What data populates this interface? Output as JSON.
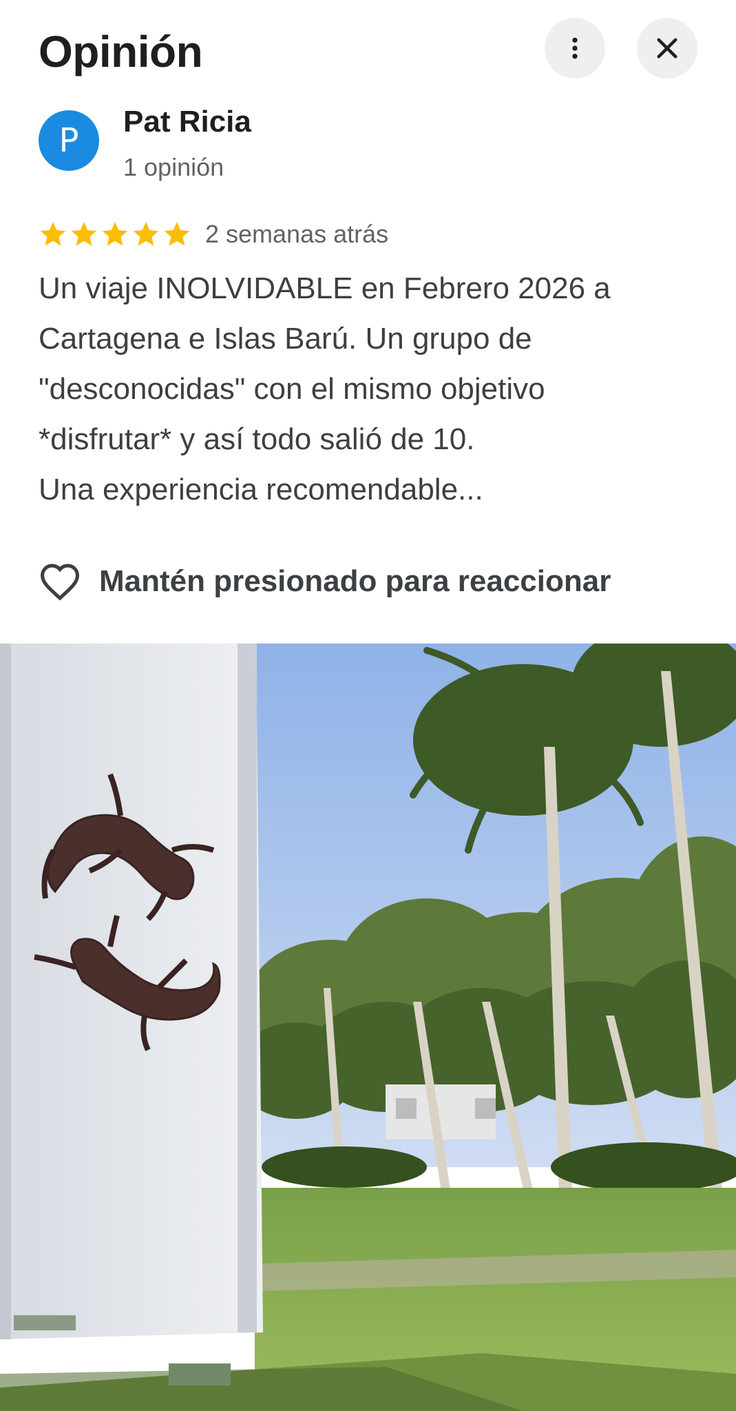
{
  "header": {
    "title": "Opinión",
    "more_icon": "more-vert-icon",
    "close_icon": "close-icon"
  },
  "author": {
    "initial": "P",
    "name": "Pat Ricia",
    "review_count": "1 opinión",
    "avatar_color": "#1a8be0"
  },
  "review": {
    "rating": 5,
    "max_rating": 5,
    "star_color": "#fbbc04",
    "date": "2 semanas atrás",
    "text": "Un viaje INOLVIDABLE en Febrero 2026 a\nCartagena e Islas Barú. Un grupo de\n\"desconocidas\" con el mismo objetivo\n*disfrutar* y así todo salió de 10.\nUna experiencia recomendable..."
  },
  "reaction": {
    "icon": "heart-outline-icon",
    "label": "Mantén presionado para reaccionar"
  },
  "photo": {
    "subject": "review-photo"
  }
}
